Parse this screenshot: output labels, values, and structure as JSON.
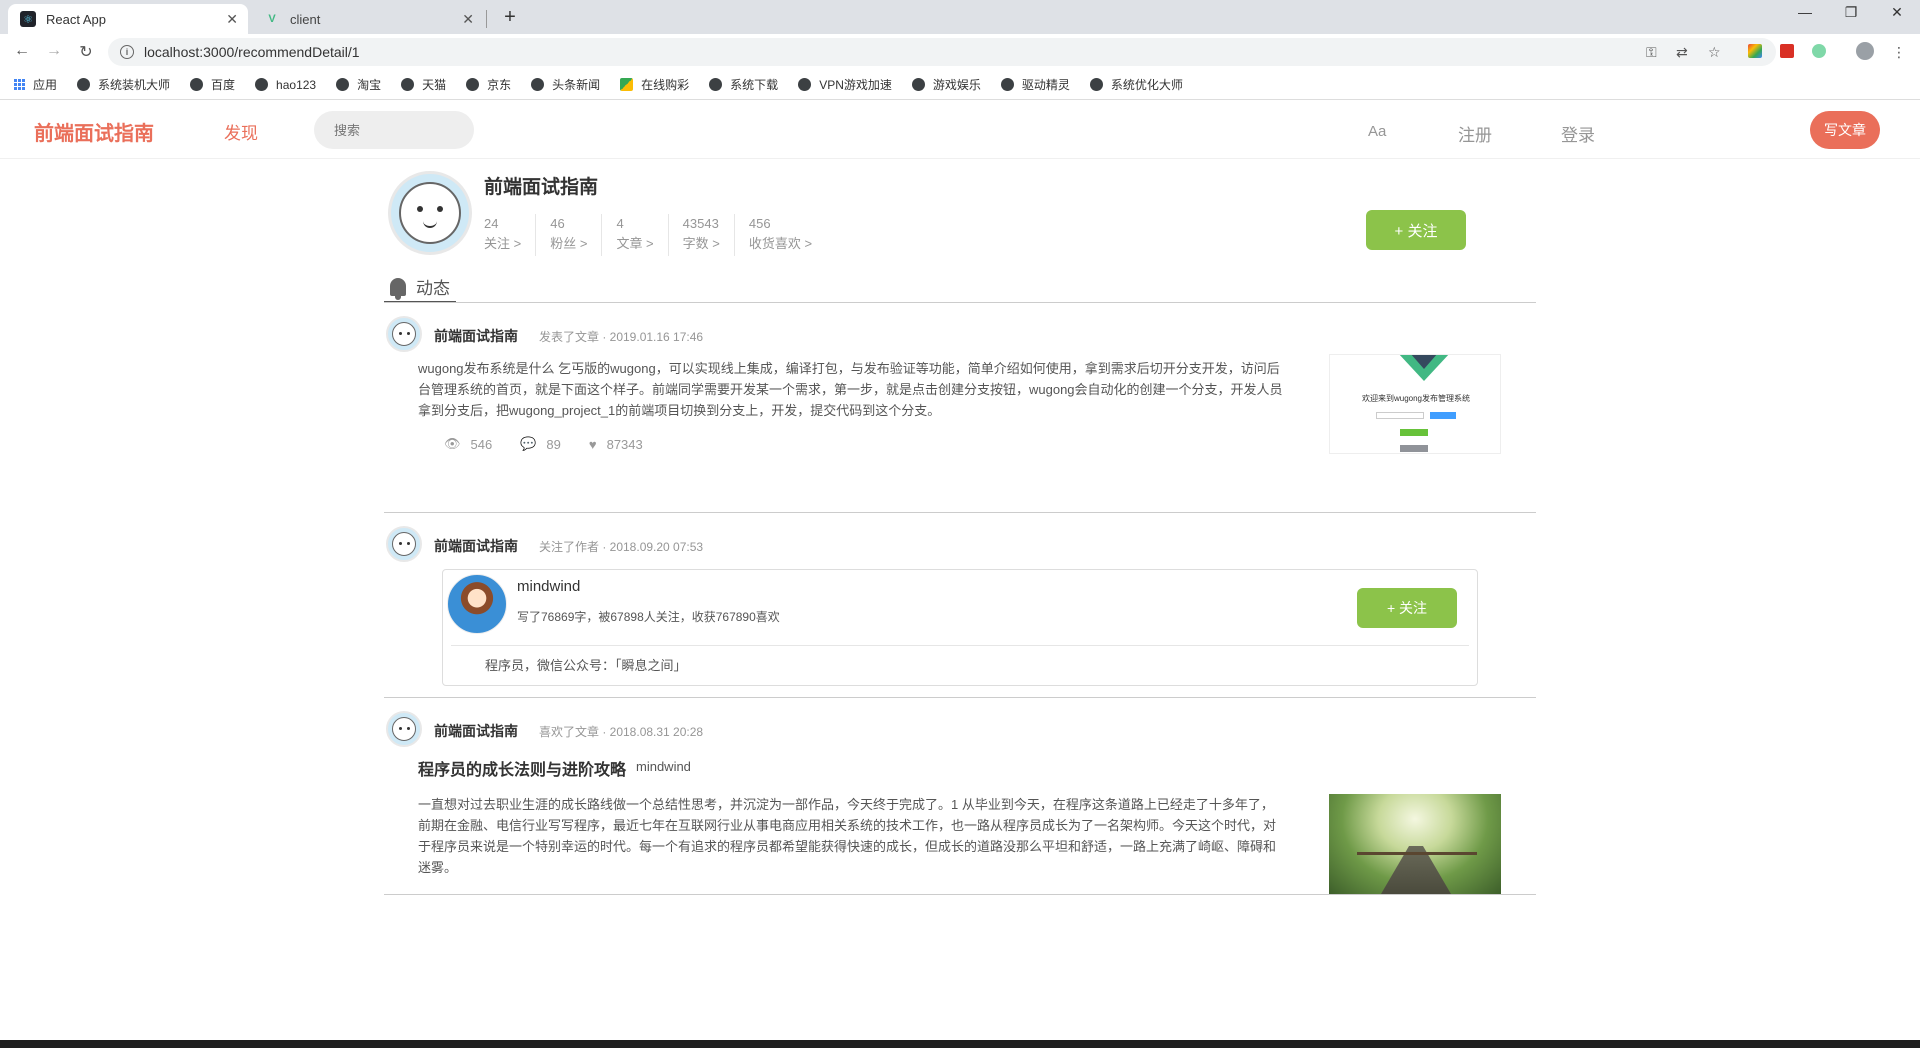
{
  "browser": {
    "tabs": [
      {
        "title": "React App",
        "active": true
      },
      {
        "title": "client",
        "active": false
      }
    ],
    "url": "localhost:3000/recommendDetail/1",
    "bookmarks": [
      "应用",
      "系统装机大师",
      "百度",
      "hao123",
      "淘宝",
      "天猫",
      "京东",
      "头条新闻",
      "在线购彩",
      "系统下载",
      "VPN游戏加速",
      "游戏娱乐",
      "驱动精灵",
      "系统优化大师"
    ]
  },
  "header": {
    "logo": "前端面试指南",
    "nav_discover": "发现",
    "search_placeholder": "搜索",
    "font_icon": "Aa",
    "register": "注册",
    "login": "登录",
    "write": "写文章"
  },
  "profile": {
    "name": "前端面试指南",
    "stats": [
      {
        "value": "24",
        "label": "关注 >"
      },
      {
        "value": "46",
        "label": "粉丝 >"
      },
      {
        "value": "4",
        "label": "文章 >"
      },
      {
        "value": "43543",
        "label": "字数 >"
      },
      {
        "value": "456",
        "label": "收货喜欢 >"
      }
    ],
    "follow": "+ 关注"
  },
  "feed_tab": "动态",
  "feed": [
    {
      "author": "前端面试指南",
      "meta": "发表了文章 · 2019.01.16 17:46",
      "abstract": "wugong发布系统是什么 乞丐版的wugong，可以实现线上集成，编译打包，与发布验证等功能，简单介绍如何使用，拿到需求后切开分支开发，访问后台管理系统的首页，就是下面这个样子。前端同学需要开发某一个需求，第一步，就是点击创建分支按钮，wugong会自动化的创建一个分支，开发人员拿到分支后，把wugong_project_1的前端项目切换到分支上，开发，提交代码到这个分支。",
      "views": "546",
      "comments": "89",
      "likes": "87343",
      "thumb_title": "欢迎来到wugong发布管理系统"
    },
    {
      "author": "前端面试指南",
      "meta": "关注了作者 · 2018.09.20 07:53",
      "followed_author": {
        "name": "mindwind",
        "info": "写了76869字，被67898人关注，收获767890喜欢",
        "desc": "程序员，微信公众号：「瞬息之间」",
        "follow": "+ 关注"
      }
    },
    {
      "author": "前端面试指南",
      "meta": "喜欢了文章 · 2018.08.31 20:28",
      "title": "程序员的成长法则与进阶攻略",
      "title_author": "mindwind",
      "abstract": "一直想对过去职业生涯的成长路线做一个总结性思考，并沉淀为一部作品，今天终于完成了。1 从毕业到今天，在程序这条道路上已经走了十多年了，前期在金融、电信行业写写程序，最近七年在互联网行业从事电商应用相关系统的技术工作，也一路从程序员成长为了一名架构师。今天这个时代，对于程序员来说是一个特别幸运的时代。每一个有追求的程序员都希望能获得快速的成长，但成长的道路没那么平坦和舒适，一路上充满了崎岖、障碍和迷雾。"
    }
  ],
  "colors": {
    "brand": "#ea6f5a",
    "follow": "#8cc34a"
  }
}
